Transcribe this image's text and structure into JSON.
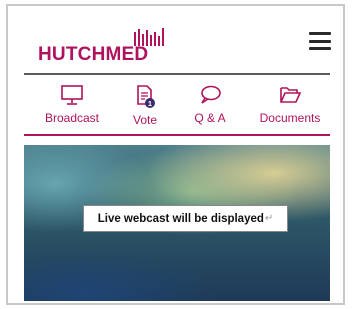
{
  "header": {
    "logo_text": "HUTCHMED",
    "brand_color": "#b0135d",
    "menu_icon": "hamburger-icon"
  },
  "tabs": [
    {
      "label": "Broadcast",
      "icon": "monitor-icon",
      "active": true
    },
    {
      "label": "Vote",
      "icon": "document-icon",
      "badge": "1"
    },
    {
      "label": "Q & A",
      "icon": "speech-bubble-icon"
    },
    {
      "label": "Documents",
      "icon": "folder-icon"
    }
  ],
  "video": {
    "placeholder_text": "Live webcast will be displayed",
    "return_mark": "↵"
  }
}
